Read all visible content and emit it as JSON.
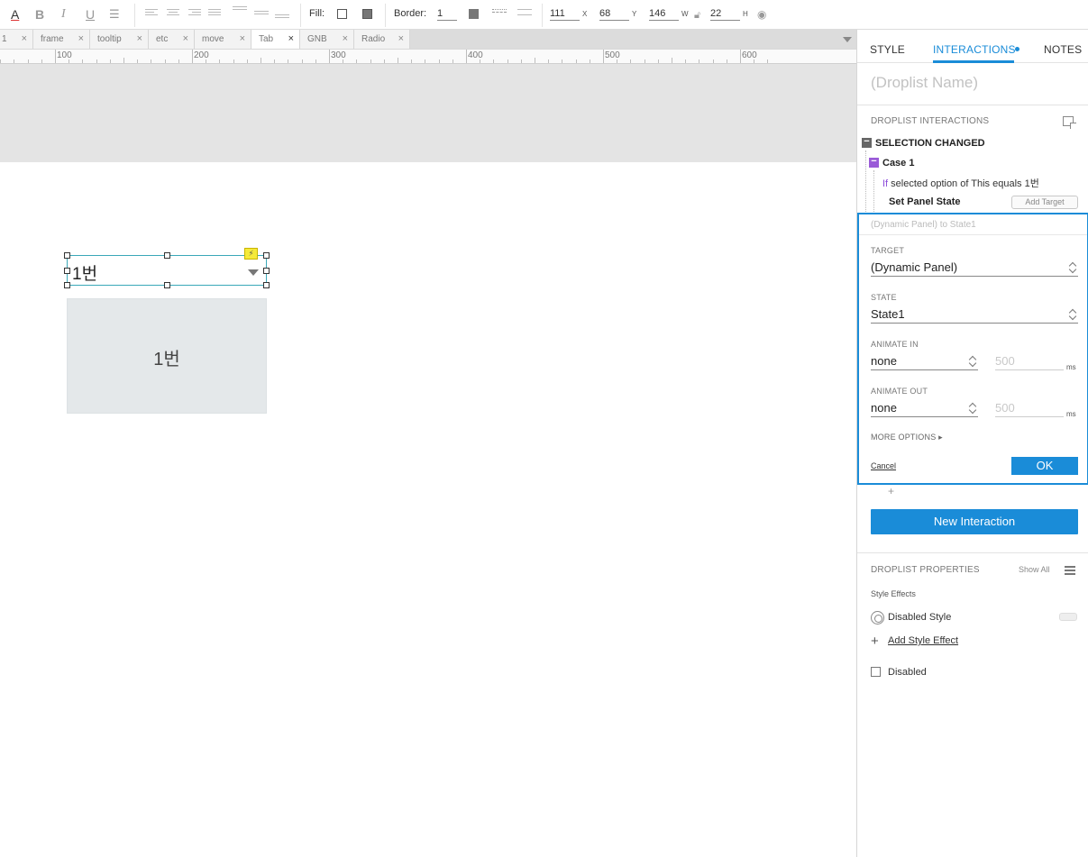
{
  "toolbar": {
    "fill_label": "Fill:",
    "border_label": "Border:",
    "border_value": "1",
    "x_value": "111",
    "x_unit": "X",
    "y_value": "68",
    "y_unit": "Y",
    "w_value": "146",
    "w_unit": "W",
    "h_value": "22",
    "h_unit": "H",
    "format_icons": [
      "font-color-icon",
      "bold-icon",
      "italic-icon",
      "underline-icon",
      "bullet-list-icon"
    ],
    "colors": {
      "fill_swatch": "#ffffff",
      "border_swatch": "#777777"
    }
  },
  "tabs": [
    {
      "label": "1"
    },
    {
      "label": "frame"
    },
    {
      "label": "tooltip"
    },
    {
      "label": "etc"
    },
    {
      "label": "move"
    },
    {
      "label": "Tab"
    },
    {
      "label": "GNB"
    },
    {
      "label": "Radio"
    }
  ],
  "ruler": {
    "labels": [
      "100",
      "200",
      "300",
      "400",
      "500",
      "600"
    ]
  },
  "canvas": {
    "droplist_value": "1번",
    "panel_text": "1번",
    "colors": {
      "band": "#e4e4e4",
      "panel": "#e4e8ea",
      "selection": "#3aa8b8",
      "interaction_badge": "#f5ea3a"
    }
  },
  "inspector": {
    "tabs": {
      "style": "STYLE",
      "interactions": "INTERACTIONS",
      "notes": "NOTES"
    },
    "widget_name_placeholder": "(Droplist Name)",
    "section_interactions": "DROPLIST INTERACTIONS",
    "event": "SELECTION CHANGED",
    "case": "Case 1",
    "condition_if": "If",
    "condition_rest": " selected option of This equals 1번",
    "action": "Set Panel State",
    "add_target": "Add Target",
    "editor": {
      "summary": "(Dynamic Panel) to State1",
      "target_label": "TARGET",
      "target_value": "(Dynamic Panel)",
      "state_label": "STATE",
      "state_value": "State1",
      "animate_in_label": "ANIMATE IN",
      "animate_in_value": "none",
      "animate_in_ms": "500",
      "animate_out_label": "ANIMATE OUT",
      "animate_out_value": "none",
      "animate_out_ms": "500",
      "ms_unit": "ms",
      "more_options": "MORE OPTIONS ▸",
      "cancel": "Cancel",
      "ok": "OK"
    },
    "plus": "+",
    "new_interaction": "New Interaction",
    "section_properties": "DROPLIST PROPERTIES",
    "show_all": "Show All",
    "style_effects": "Style Effects",
    "disabled_style": "Disabled Style",
    "add_style_effect": "Add Style Effect",
    "disabled": "Disabled",
    "colors": {
      "accent": "#1a8cd8",
      "condition_keyword": "#8c4bd9",
      "case_marker": "#9a5bd8"
    }
  }
}
